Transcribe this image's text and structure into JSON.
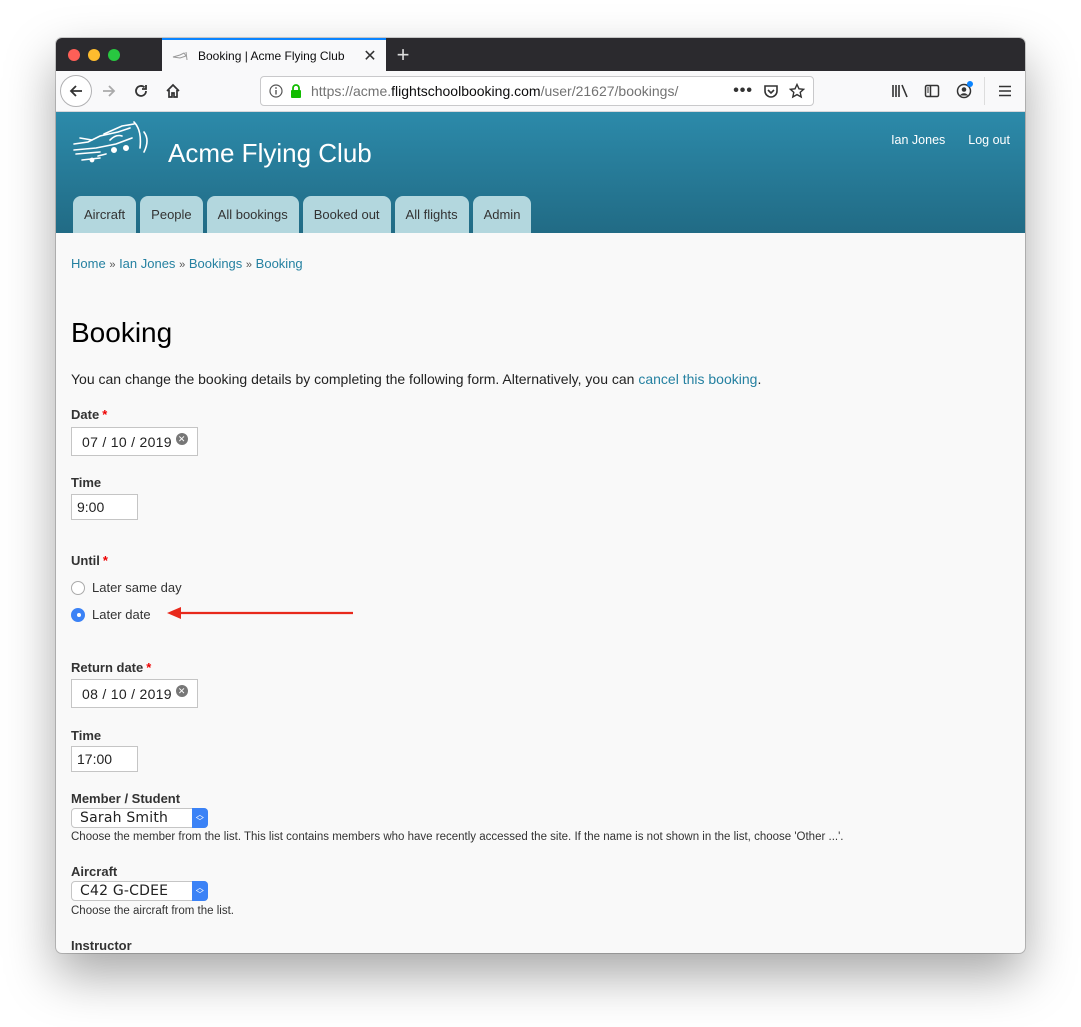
{
  "browser": {
    "tab_title": "Booking | Acme Flying Club",
    "url_scheme": "https://acme.",
    "url_host": "flightschoolbooking.com",
    "url_path": "/user/21627/bookings/",
    "new_tab_label": "+"
  },
  "header": {
    "site_name": "Acme Flying Club",
    "user_links": [
      {
        "label": "Ian Jones"
      },
      {
        "label": "Log out"
      }
    ],
    "nav_tabs": [
      {
        "label": "Aircraft"
      },
      {
        "label": "People"
      },
      {
        "label": "All bookings"
      },
      {
        "label": "Booked out"
      },
      {
        "label": "All flights"
      },
      {
        "label": "Admin"
      }
    ]
  },
  "breadcrumb": {
    "separator": "»",
    "items": [
      {
        "label": "Home"
      },
      {
        "label": "Ian Jones"
      },
      {
        "label": "Bookings"
      },
      {
        "label": "Booking"
      }
    ]
  },
  "page": {
    "title": "Booking",
    "intro_text": "You can change the booking details by completing the following form. Alternatively, you can ",
    "intro_link": "cancel this booking",
    "intro_end": "."
  },
  "form": {
    "required_marker": "*",
    "date": {
      "label": "Date",
      "value": "07 / 10 / 2019"
    },
    "time": {
      "label": "Time",
      "value": "9:00"
    },
    "until": {
      "label": "Until",
      "options": [
        {
          "label": "Later same day",
          "checked": false
        },
        {
          "label": "Later date",
          "checked": true
        }
      ]
    },
    "return_date": {
      "label": "Return date",
      "value": "08 / 10 / 2019"
    },
    "return_time": {
      "label": "Time",
      "value": "17:00"
    },
    "member": {
      "label": "Member / Student",
      "value": "Sarah Smith",
      "help": "Choose the member from the list. This list contains members who have recently accessed the site. If the name is not shown in the list, choose 'Other ...'."
    },
    "aircraft": {
      "label": "Aircraft",
      "value": "C42 G-CDEE",
      "help": "Choose the aircraft from the list."
    },
    "instructor": {
      "label": "Instructor"
    }
  },
  "colors": {
    "header_top": "#2c8aaa",
    "header_bottom": "#216b85",
    "tab_bg": "#b3d7de",
    "link": "#2581a1",
    "required": "#ee0000",
    "annotation_arrow": "#e8291c",
    "radio_checked": "#3b82f6"
  }
}
